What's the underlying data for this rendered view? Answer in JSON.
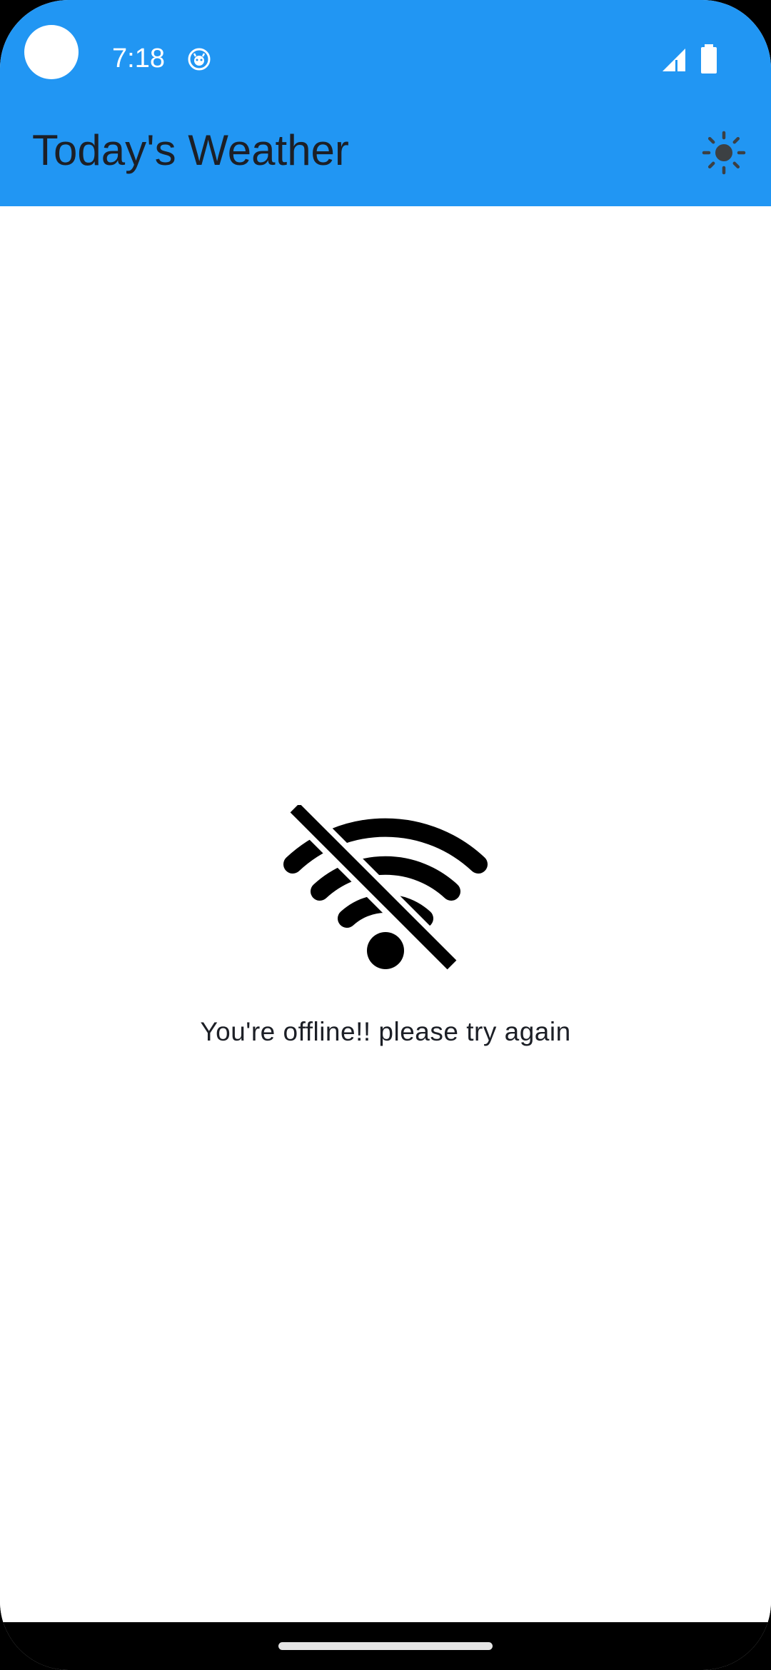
{
  "status_bar": {
    "time": "7:18",
    "icons": [
      "camera-cutout",
      "notification-icon",
      "cellular-signal-icon",
      "battery-icon"
    ]
  },
  "app_bar": {
    "title": "Today's Weather",
    "action_icon": "sun-icon"
  },
  "main": {
    "icon": "wifi-off-icon",
    "message": "You're offline!! please try again"
  },
  "colors": {
    "app_bar": "#2196f3",
    "title_text": "#1c1f26",
    "background": "#ffffff",
    "sun_icon": "#3c4043",
    "nav_bar": "#000000"
  }
}
